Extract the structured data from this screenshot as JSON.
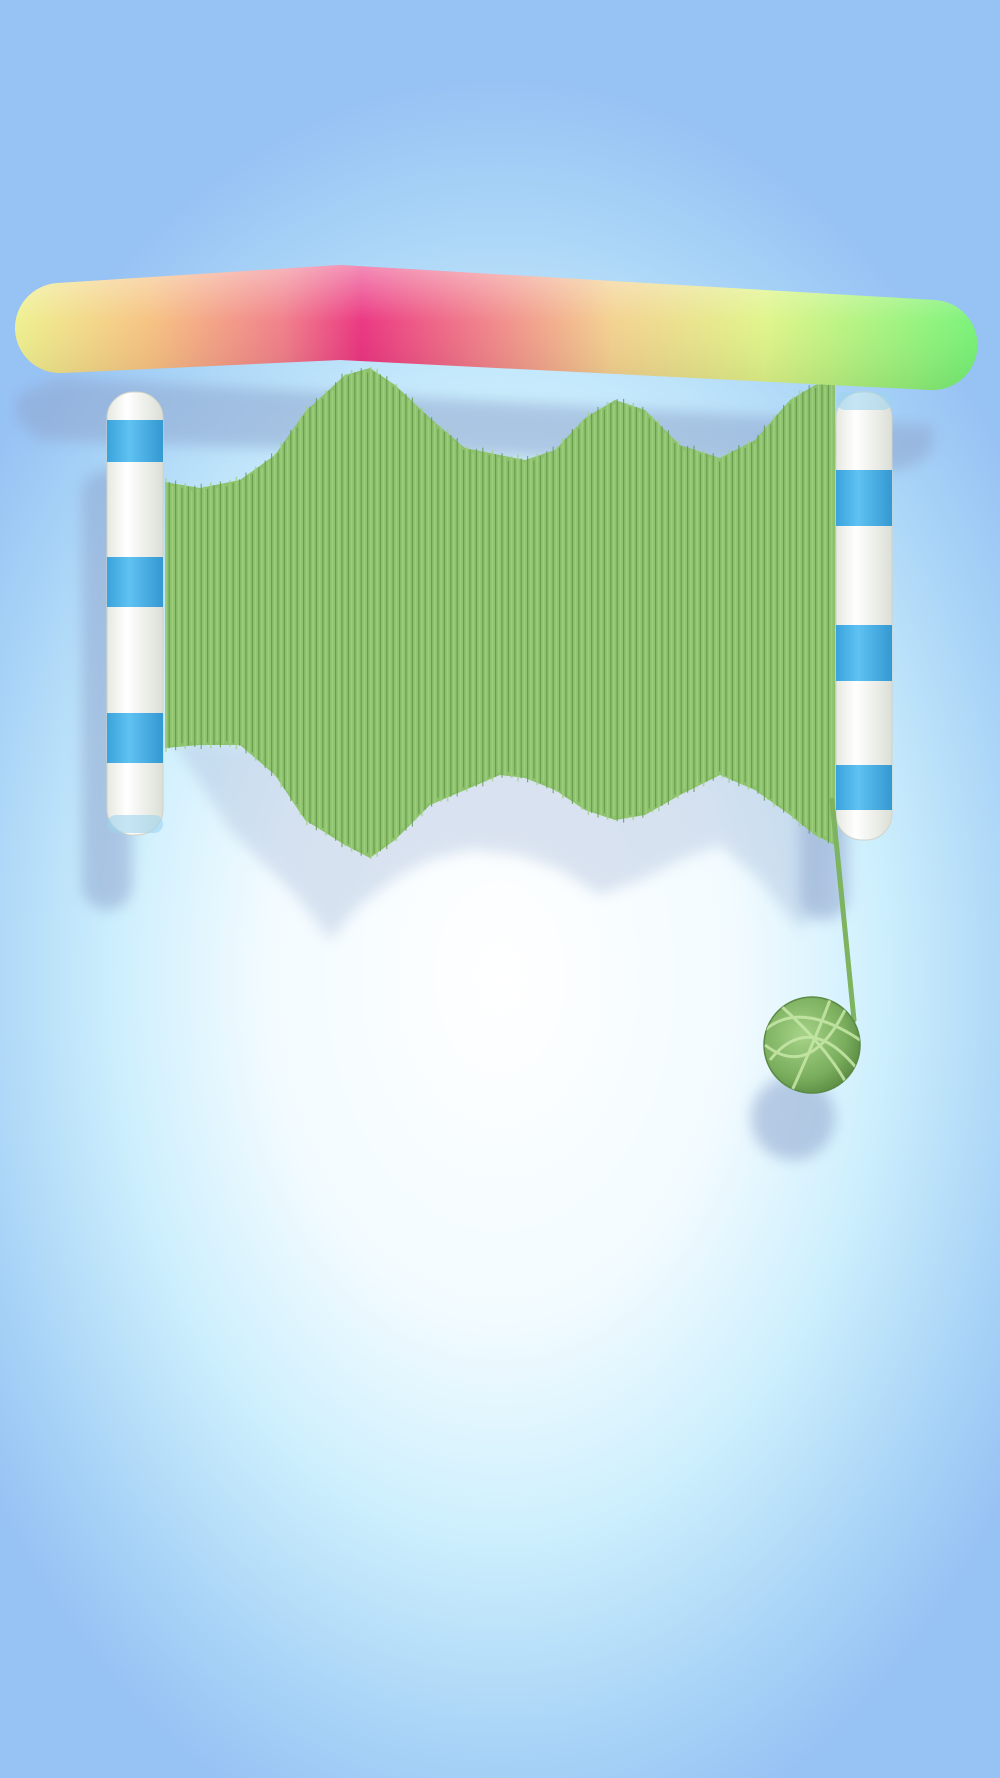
{
  "scene": {
    "name": "yarn-spool-puzzle",
    "colors": {
      "background_center": "#ffffff",
      "background_edge": "#97c2f4",
      "yarn": "#8cc26c",
      "yarn_dark": "#5f9446",
      "stripe_blue": "#4db3ea",
      "post_white": "#fbfbf6",
      "bar_gradient": [
        "#eef08c",
        "#f6a07a",
        "#ea2f7d",
        "#f08a86",
        "#eaf08e",
        "#d6f47e",
        "#7ef374"
      ]
    },
    "icons": {
      "spool": "yarn-spool-icon",
      "ball": "yarn-ball-icon",
      "bar": "gradient-bar-icon"
    }
  }
}
